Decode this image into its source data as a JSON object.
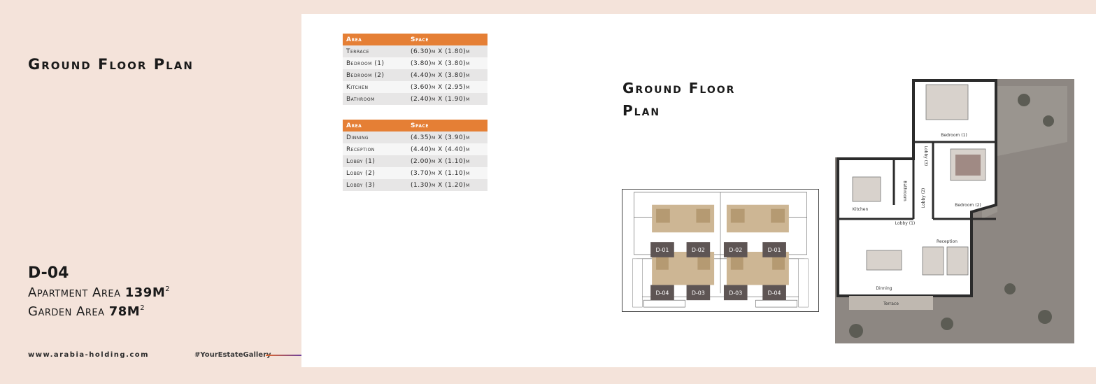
{
  "left": {
    "title": "Ground Floor Plan",
    "unit_code": "D-04",
    "apartment_area_label": "Apartment Area",
    "apartment_area_value": "139M",
    "garden_area_label": "Garden Area",
    "garden_area_value": "78M",
    "area_unit_sup": "2",
    "footer_url": "www.arabia-holding.com",
    "footer_tag": "#YourEstateGallery"
  },
  "table1": {
    "headers": [
      "Area",
      "Space"
    ],
    "rows": [
      [
        "Terrace",
        "(6.30)m X (1.80)m"
      ],
      [
        "Bedroom (1)",
        "(3.80)m X (3.80)m"
      ],
      [
        "Bedroom (2)",
        "(4.40)m X (3.80)m"
      ],
      [
        "Kitchen",
        "(3.60)m X (2.95)m"
      ],
      [
        "Bathroom",
        "(2.40)m X (1.90)m"
      ]
    ]
  },
  "table2": {
    "headers": [
      "Area",
      "Space"
    ],
    "rows": [
      [
        "Dinning",
        "(4.35)m X (3.90)m"
      ],
      [
        "Reception",
        "(4.40)m X (4.40)m"
      ],
      [
        "Lobby (1)",
        "(2.00)m X (1.10)m"
      ],
      [
        "Lobby (2)",
        "(3.70)m X (1.10)m"
      ],
      [
        "Lobby (3)",
        "(1.30)m X (1.20)m"
      ]
    ]
  },
  "right": {
    "title_line1": "Ground Floor",
    "title_line2": "Plan"
  },
  "siteplan": {
    "units_top": [
      "D-01",
      "D-02",
      "D-02",
      "D-01"
    ],
    "units_bottom": [
      "D-04",
      "D-03",
      "D-03",
      "D-04"
    ]
  },
  "floorplan": {
    "rooms": [
      "Bedroom (1)",
      "Lobby (3)",
      "Bedroom (2)",
      "Bathroom",
      "Lobby (2)",
      "Kitchen",
      "Lobby (1)",
      "Reception",
      "Dinning",
      "Terrace"
    ]
  },
  "colors": {
    "accent": "#e57f35",
    "background": "#f4e3da",
    "unit_box": "#5e5554"
  }
}
